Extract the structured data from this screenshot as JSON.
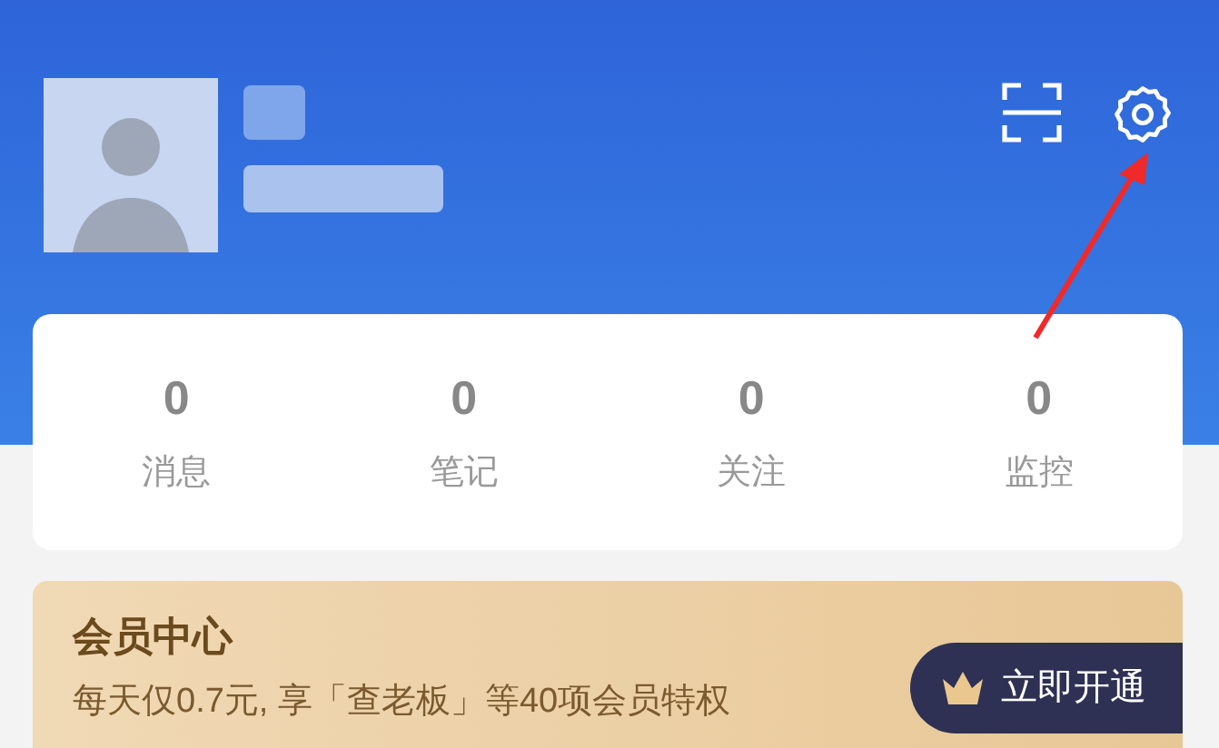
{
  "header": {
    "actions": [
      {
        "kind": "scan"
      },
      {
        "kind": "settings"
      }
    ]
  },
  "stats": [
    {
      "value": "0",
      "label": "消息"
    },
    {
      "value": "0",
      "label": "笔记"
    },
    {
      "value": "0",
      "label": "关注"
    },
    {
      "value": "0",
      "label": "监控"
    }
  ],
  "membership": {
    "title": "会员中心",
    "description": "每天仅0.7元, 享「查老板」等40项会员特权",
    "button": "立即开通"
  }
}
